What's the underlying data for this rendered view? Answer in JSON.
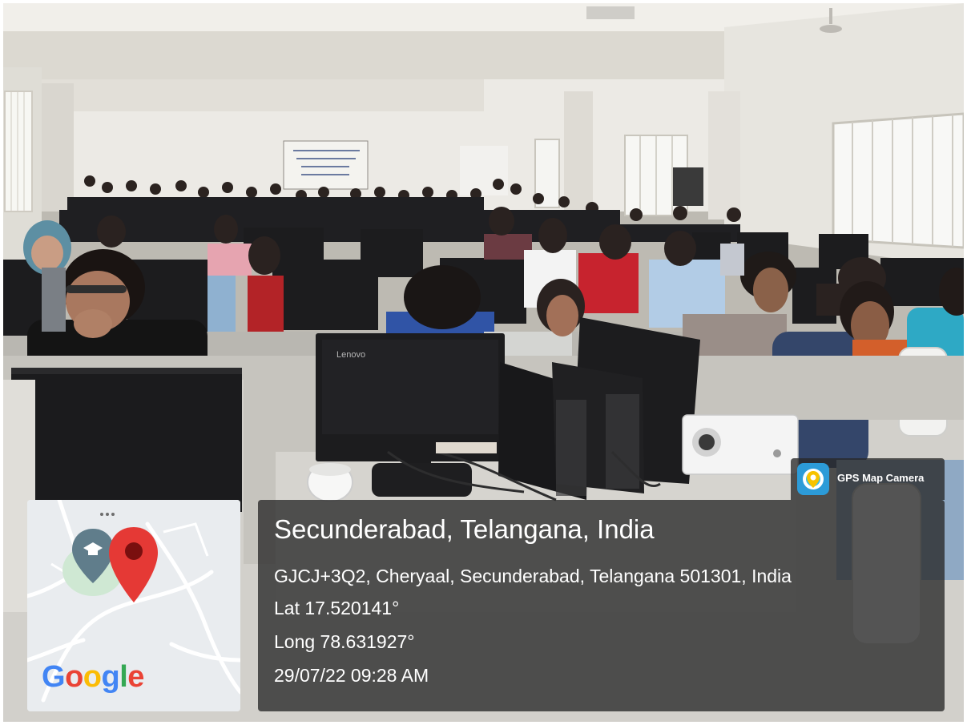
{
  "overlay": {
    "place_title": "Secunderabad, Telangana, India",
    "address": "GJCJ+3Q2, Cheryaal, Secunderabad, Telangana 501301, India",
    "latitude": "Lat 17.520141°",
    "longitude": "Long 78.631927°",
    "datetime": "29/07/22 09:28 AM",
    "app_badge": "GPS Map Camera",
    "map_brand": "Google"
  },
  "poster_text": "",
  "monitor_brand": "Lenovo",
  "icons": [
    "map-pin-icon",
    "school-place-icon",
    "gps-map-camera-app-icon",
    "more-dots-icon"
  ],
  "colors": {
    "overlay_background": "#282828",
    "overlay_text": "#ffffff",
    "map_pin": "#e53935",
    "map_school_marker": "#607d8b",
    "google_blue": "#4285F4",
    "google_red": "#EA4335",
    "google_yellow": "#FBBC05",
    "google_green": "#34A853"
  }
}
